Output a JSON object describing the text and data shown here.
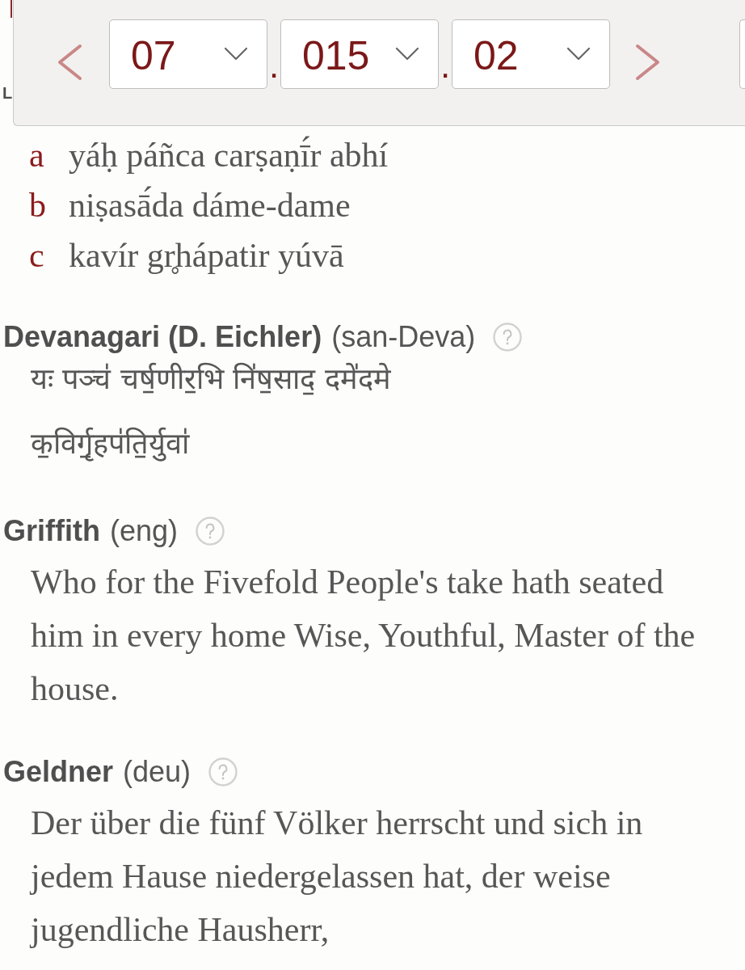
{
  "toolbar": {
    "selectors": [
      {
        "value": "07"
      },
      {
        "value": "015"
      },
      {
        "value": "02"
      }
    ],
    "separators": [
      ".",
      "."
    ]
  },
  "hidden_heading": "L",
  "stanza_lines": [
    {
      "label": "a",
      "text": "yáḥ páñca carṣaṇī́r abhí"
    },
    {
      "label": "b",
      "text": "niṣasā́da dáme-dame"
    },
    {
      "label": "c",
      "text": "kavír gr̥hápatir yúvā"
    }
  ],
  "versions": [
    {
      "kind": "verse",
      "name": "Devanagari (D. Eichler)",
      "language": "(san-Deva)",
      "lines": [
        "यः पञ्च॑ चर्ष॒णीर॒भि नि॑ष॒साद॒ दमे॑दमे",
        "क॒विर्गृ॒हप॑ति॒र्युवा॑"
      ]
    },
    {
      "kind": "prose",
      "name": "Griffith",
      "language": "(eng)",
      "text": "Who for the Fivefold People's take hath seated him in every home Wise, Youthful, Master of the house."
    },
    {
      "kind": "prose",
      "name": "Geldner",
      "language": "(deu)",
      "text": "Der über die fünf Völker herrscht und sich in jedem Hause niedergelassen hat, der weise jugendliche Hausherr,"
    }
  ]
}
